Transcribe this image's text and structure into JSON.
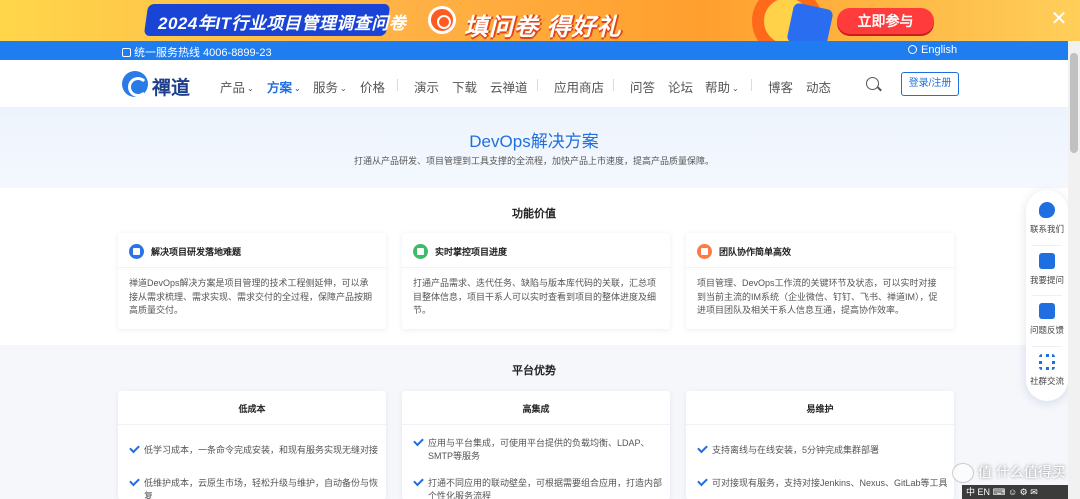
{
  "ad": {
    "title": "2024年IT行业项目管理调查问卷",
    "slogan": "填问卷 得好礼",
    "cta": "立即参与",
    "close": "✕"
  },
  "topbar": {
    "hotline": "统一服务热线  4006-8899-23",
    "language": "English"
  },
  "nav": {
    "logo_text": "禪道",
    "items": [
      {
        "label": "产品",
        "chevron": "⌄"
      },
      {
        "label": "方案",
        "chevron": "⌄"
      },
      {
        "label": "服务",
        "chevron": "⌄"
      },
      {
        "label": "价格"
      },
      {
        "label": "演示"
      },
      {
        "label": "下载"
      },
      {
        "label": "云禅道"
      },
      {
        "label": "应用商店"
      },
      {
        "label": "问答"
      },
      {
        "label": "论坛"
      },
      {
        "label": "帮助",
        "chevron": "⌄"
      },
      {
        "label": "博客"
      },
      {
        "label": "动态"
      }
    ],
    "login": "登录/注册"
  },
  "hero": {
    "title": "DevOps解决方案",
    "subtitle": "打通从产品研发、项目管理到工具支撑的全流程，加快产品上市速度，提高产品质量保障。"
  },
  "value_section": {
    "title": "功能价值",
    "cards": [
      {
        "title": "解决项目研发落地难题",
        "icon_color": "#2a73e8",
        "body": "禅道DevOps解决方案是项目管理的技术工程侧延伸，可以承接从需求梳理、需求实现、需求交付的全过程，保障产品按期高质量交付。"
      },
      {
        "title": "实时掌控项目进度",
        "icon_color": "#3dbb6b",
        "body": "打通产品需求、迭代任务、缺陷与版本库代码的关联，汇总项目整体信息，项目干系人可以实时查看到项目的整体进度及细节。"
      },
      {
        "title": "团队协作简单高效",
        "icon_color": "#ff7a45",
        "body": "项目管理、DevOps工作流的关键环节及状态，可以实时对接到当前主流的IM系统（企业微信、钉钉、飞书、禅道IM），促进项目团队及相关干系人信息互通，提高协作效率。"
      }
    ]
  },
  "advantage_section": {
    "title": "平台优势",
    "cards": [
      {
        "title": "低成本",
        "items": [
          "低学习成本，一条命令完成安装，和现有服务实现无缝对接",
          "低维护成本，云原生市场，轻松升级与维护，自动备份与恢复"
        ]
      },
      {
        "title": "高集成",
        "items": [
          "应用与平台集成，可使用平台提供的负载均衡、LDAP、SMTP等服务",
          "打通不同应用的联动壁垒，可根据需要组合应用，打造内部个性化服务流程"
        ]
      },
      {
        "title": "易维护",
        "items": [
          "支持离线与在线安装，5分钟完成集群部署",
          "可对接现有服务，支持对接Jenkins、Nexus、GitLab等工具"
        ]
      }
    ]
  },
  "float_bar": {
    "items": [
      {
        "label": "联系我们",
        "icon": "phone-icon"
      },
      {
        "label": "我要提问",
        "icon": "edit-icon"
      },
      {
        "label": "问题反馈",
        "icon": "feedback-icon"
      },
      {
        "label": "社群交流",
        "icon": "qrcode-icon"
      }
    ]
  },
  "watermark": {
    "text": "值 什么值得买",
    "strip": "中  EN  ⌨  ☺  ⚙  ✉"
  }
}
